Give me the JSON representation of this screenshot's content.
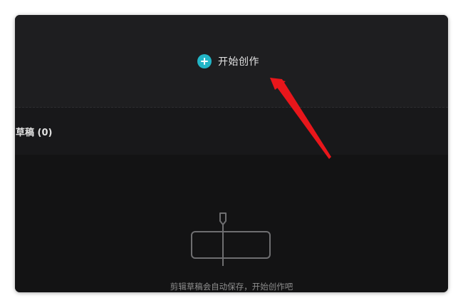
{
  "start_area": {
    "icon": "plus-circle-icon",
    "accent_color": "#22b5c6",
    "label": "开始创作"
  },
  "drafts": {
    "title": "草稿 (0)",
    "empty_icon": "timeline-editor-icon",
    "empty_message": "剪辑草稿会自动保存，开始创作吧"
  },
  "annotation": {
    "type": "arrow",
    "color": "#e8161b"
  }
}
